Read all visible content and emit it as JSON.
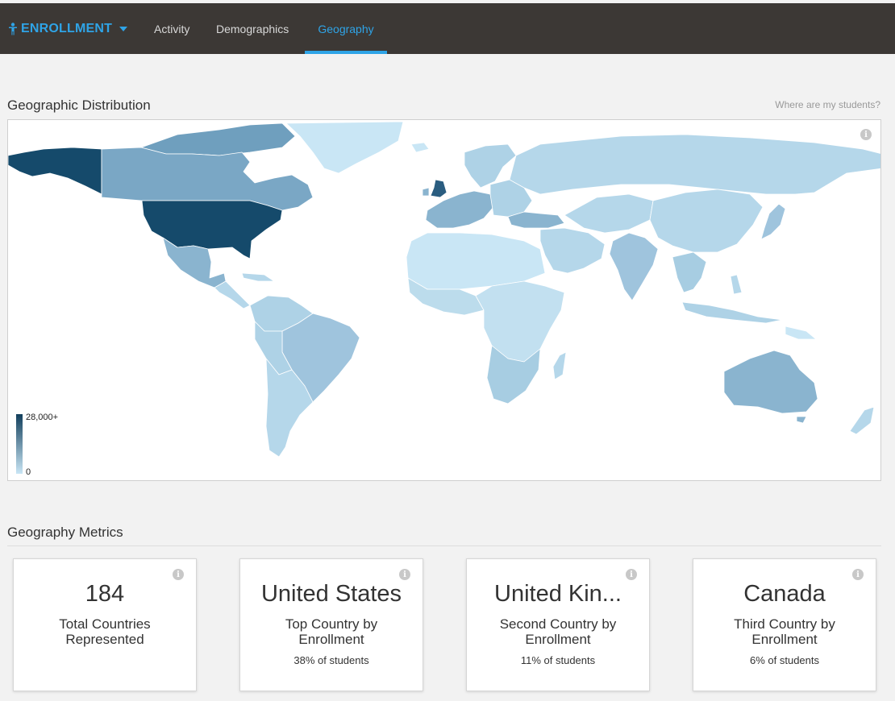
{
  "app": {
    "brand_label": "ENROLLMENT",
    "accent_color": "#2fa4e7"
  },
  "nav": {
    "tabs": [
      {
        "label": "Activity",
        "active": false
      },
      {
        "label": "Demographics",
        "active": false
      },
      {
        "label": "Geography",
        "active": true
      }
    ]
  },
  "map_section": {
    "title": "Geographic Distribution",
    "help_link": "Where are my students?",
    "legend": {
      "max_label": "28,000+",
      "min_label": "0",
      "color_max": "#123f5c",
      "color_min": "#c9e6f5"
    }
  },
  "metrics_section": {
    "title": "Geography Metrics",
    "cards": [
      {
        "value": "184",
        "label": "Total Countries Represented",
        "sub": ""
      },
      {
        "value": "United States",
        "label": "Top Country by Enrollment",
        "sub": "38% of students"
      },
      {
        "value": "United Kin...",
        "label": "Second Country by Enrollment",
        "sub": "11% of students"
      },
      {
        "value": "Canada",
        "label": "Third Country by Enrollment",
        "sub": "6% of students"
      }
    ]
  },
  "icons": {
    "info": "i"
  }
}
